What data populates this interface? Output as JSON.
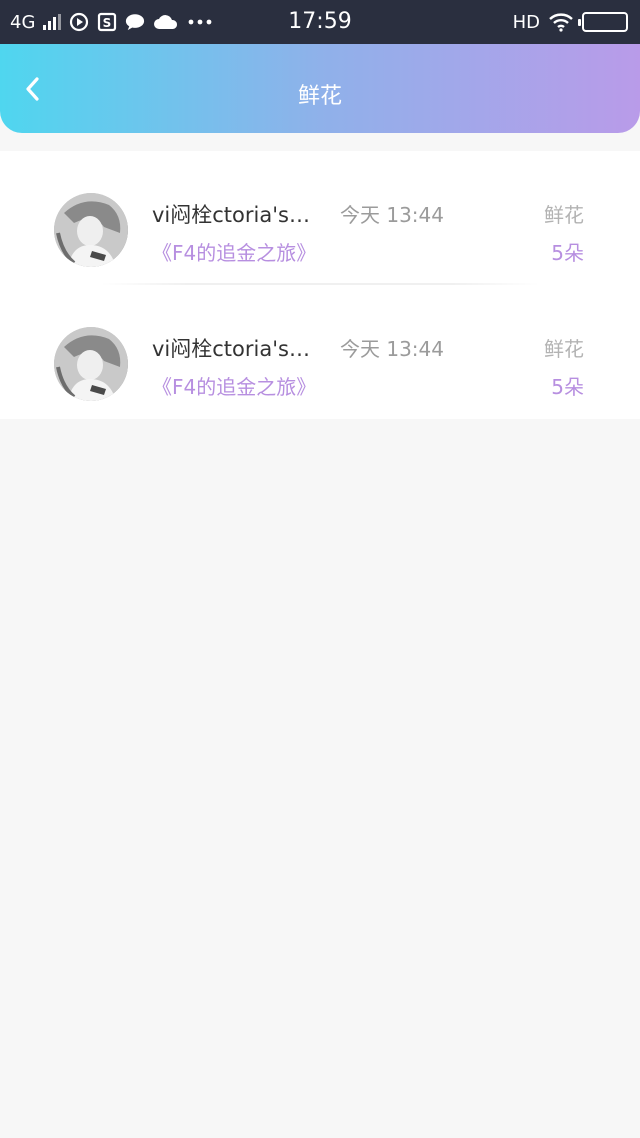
{
  "status_bar": {
    "network": "4G",
    "time": "17:59",
    "hd": "HD",
    "icons": [
      "signal-icon",
      "play-circle-icon",
      "s-app-icon",
      "chat-bubble-icon",
      "cloud-icon",
      "more-dots-icon",
      "wifi-icon",
      "battery-icon"
    ]
  },
  "header": {
    "title": "鲜花",
    "back_icon": "chevron-left-icon",
    "gradient": [
      "#4fd6ef",
      "#b99be9"
    ]
  },
  "records": [
    {
      "user": "vi闷栓ctoria's…",
      "time": "今天 13:44",
      "type": "鲜花",
      "book": "《F4的追金之旅》",
      "count": "5朵"
    },
    {
      "user": "vi闷栓ctoria's…",
      "time": "今天 13:44",
      "type": "鲜花",
      "book": "《F4的追金之旅》",
      "count": "5朵"
    }
  ],
  "colors": {
    "accent_purple": "#b78fe0",
    "muted_gray": "#9b9b9b",
    "page_bg": "#f7f7f7"
  }
}
